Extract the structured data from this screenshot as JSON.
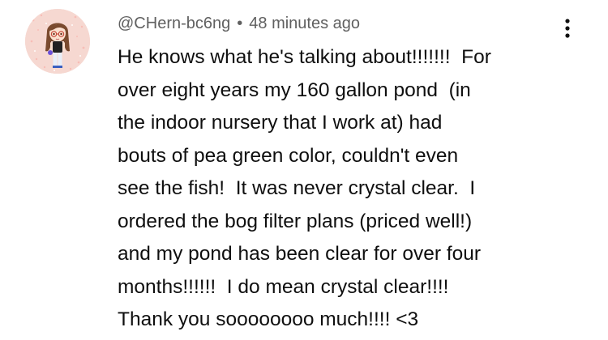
{
  "comment": {
    "author": "@CHern-bc6ng",
    "separator": "•",
    "timestamp": "48 minutes ago",
    "avatar_icon": "cartoon-girl-avatar-icon",
    "menu_icon": "more-vert-icon",
    "lines": [
      "He knows what he's talking about!!!!!!!  For",
      "over eight years my 160 gallon pond  (in",
      "the indoor nursery that I work at) had",
      "bouts of pea green color, couldn't even",
      "see the fish!  It was never crystal clear.  I",
      "ordered the bog filter plans (priced well!)",
      "and my pond has been clear for over four",
      "months!!!!!!  I do mean crystal clear!!!!",
      "Thank you soooooooo much!!!! <3"
    ]
  },
  "colors": {
    "meta_text": "#606060",
    "body_text": "#0f0f0f",
    "avatar_bg": "#f7d9d2"
  }
}
